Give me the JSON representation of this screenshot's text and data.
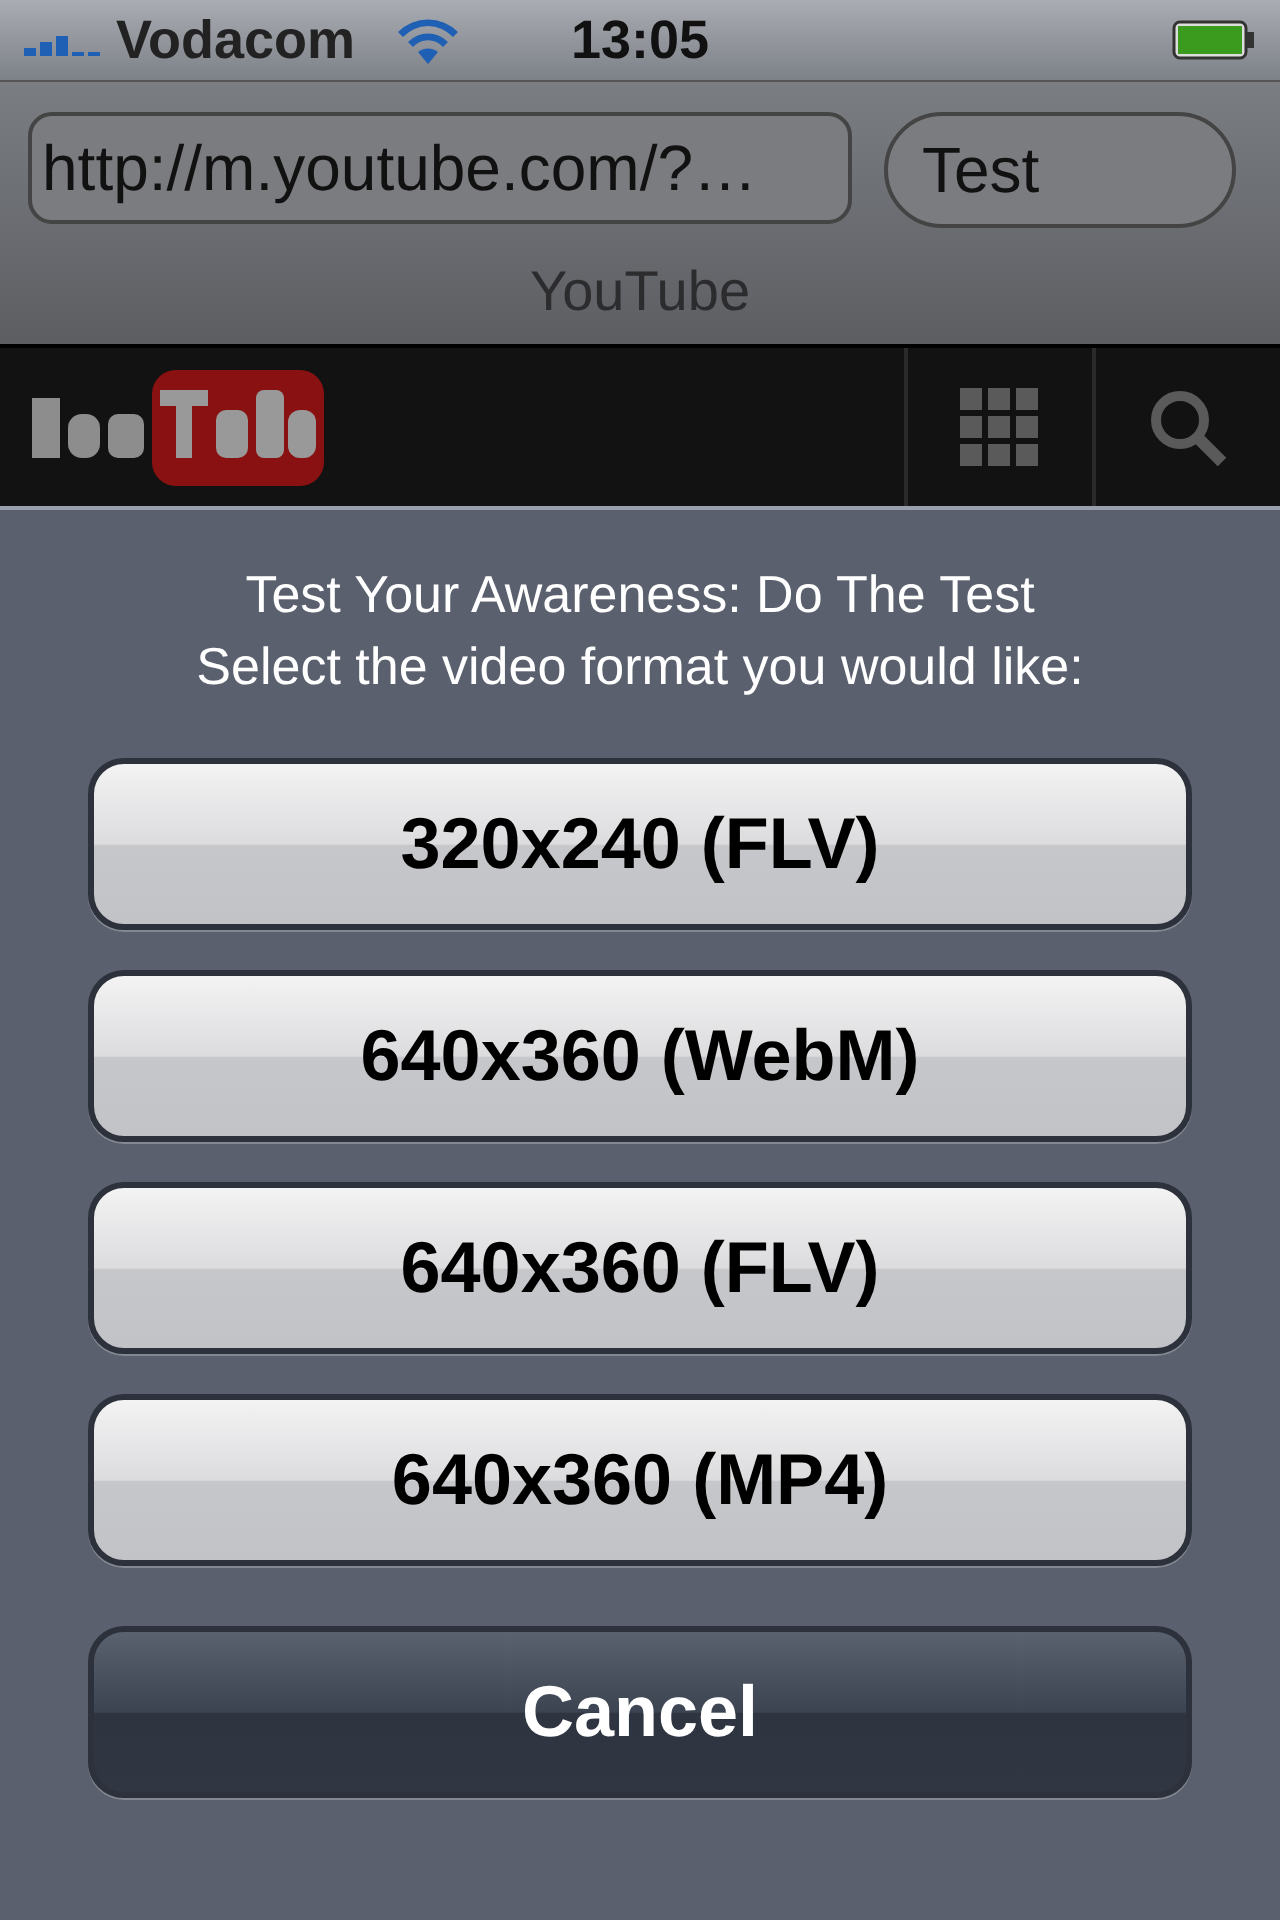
{
  "status_bar": {
    "carrier": "Vodacom",
    "time": "13:05"
  },
  "browser": {
    "url": "http://m.youtube.com/?…",
    "search": "Test",
    "page_title": "YouTube"
  },
  "action_sheet": {
    "title": "Test Your Awareness: Do The Test",
    "message": "Select the video format you would like:",
    "options": [
      {
        "label": "320x240 (FLV)",
        "kind": "option"
      },
      {
        "label": "640x360 (WebM)",
        "kind": "option"
      },
      {
        "label": "640x360 (FLV)",
        "kind": "option"
      },
      {
        "label": "640x360 (MP4)",
        "kind": "option"
      },
      {
        "label": "Cancel",
        "kind": "cancel"
      }
    ]
  }
}
